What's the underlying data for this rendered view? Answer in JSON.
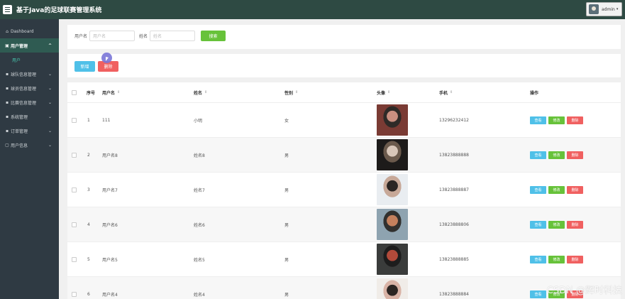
{
  "header": {
    "title": "基于Java的足球联赛管理系统",
    "user_label": "admin",
    "user_caret": "▾"
  },
  "sidebar": {
    "items": [
      {
        "icon": "⌂",
        "label": "Dashboard",
        "chevron": ""
      },
      {
        "icon": "▣",
        "label": "用户管理",
        "chevron": "^"
      },
      {
        "icon": "▪",
        "label": "球队信息管理",
        "chevron": "⌄"
      },
      {
        "icon": "▪",
        "label": "球员信息管理",
        "chevron": "⌄"
      },
      {
        "icon": "▪",
        "label": "比赛信息管理",
        "chevron": "⌄"
      },
      {
        "icon": "▪",
        "label": "系统管理",
        "chevron": "⌄"
      },
      {
        "icon": "▪",
        "label": "订单管理",
        "chevron": "⌄"
      },
      {
        "icon": "▢",
        "label": "用户信息",
        "chevron": "⌄"
      }
    ],
    "sub_item": "用户"
  },
  "search": {
    "username_label": "用户名",
    "username_placeholder": "用户名",
    "name_label": "姓名",
    "name_placeholder": "姓名",
    "search_button": "搜索"
  },
  "actions": {
    "add_button": "新增",
    "delete_button": "删除"
  },
  "table": {
    "columns": {
      "index": "序号",
      "username": "用户名",
      "name": "姓名",
      "gender": "性别",
      "avatar": "头像",
      "phone": "手机",
      "ops": "操作"
    },
    "sort_glyph": "⇕",
    "op_labels": {
      "view": "查看",
      "edit": "修改",
      "delete": "删除"
    },
    "rows": [
      {
        "index": "1",
        "username": "111",
        "name": "小明",
        "gender": "女",
        "phone": "13296232412",
        "avatar_colors": [
          "#7a3b34",
          "#c98f80",
          "#2e2a27"
        ]
      },
      {
        "index": "2",
        "username": "用户名8",
        "name": "姓名8",
        "gender": "男",
        "phone": "13823888888",
        "avatar_colors": [
          "#1d1b1a",
          "#d8c6b8",
          "#6b5a4c"
        ]
      },
      {
        "index": "3",
        "username": "用户名7",
        "name": "姓名7",
        "gender": "男",
        "phone": "13823888887",
        "avatar_colors": [
          "#e9edf1",
          "#2b2523",
          "#c7a898"
        ]
      },
      {
        "index": "4",
        "username": "用户名6",
        "name": "姓名6",
        "gender": "男",
        "phone": "13823888806",
        "avatar_colors": [
          "#8ea3b0",
          "#c4805d",
          "#31302e"
        ]
      },
      {
        "index": "5",
        "username": "用户名5",
        "name": "姓名5",
        "gender": "男",
        "phone": "13823888885",
        "avatar_colors": [
          "#3a3c3b",
          "#b24a3a",
          "#1d1d1d"
        ]
      },
      {
        "index": "6",
        "username": "用户名4",
        "name": "姓名4",
        "gender": "男",
        "phone": "13823888884",
        "avatar_colors": [
          "#f0ece8",
          "#2c2522",
          "#d9b3a6"
        ]
      }
    ]
  },
  "watermark": "CSDN @辉时科技",
  "colors": {
    "header": "#2e4a43",
    "sidebar": "#2f3a43",
    "sidebar_active": "#2f5b52",
    "green": "#67c23a",
    "blue": "#4fc0e8",
    "red": "#f06060"
  }
}
